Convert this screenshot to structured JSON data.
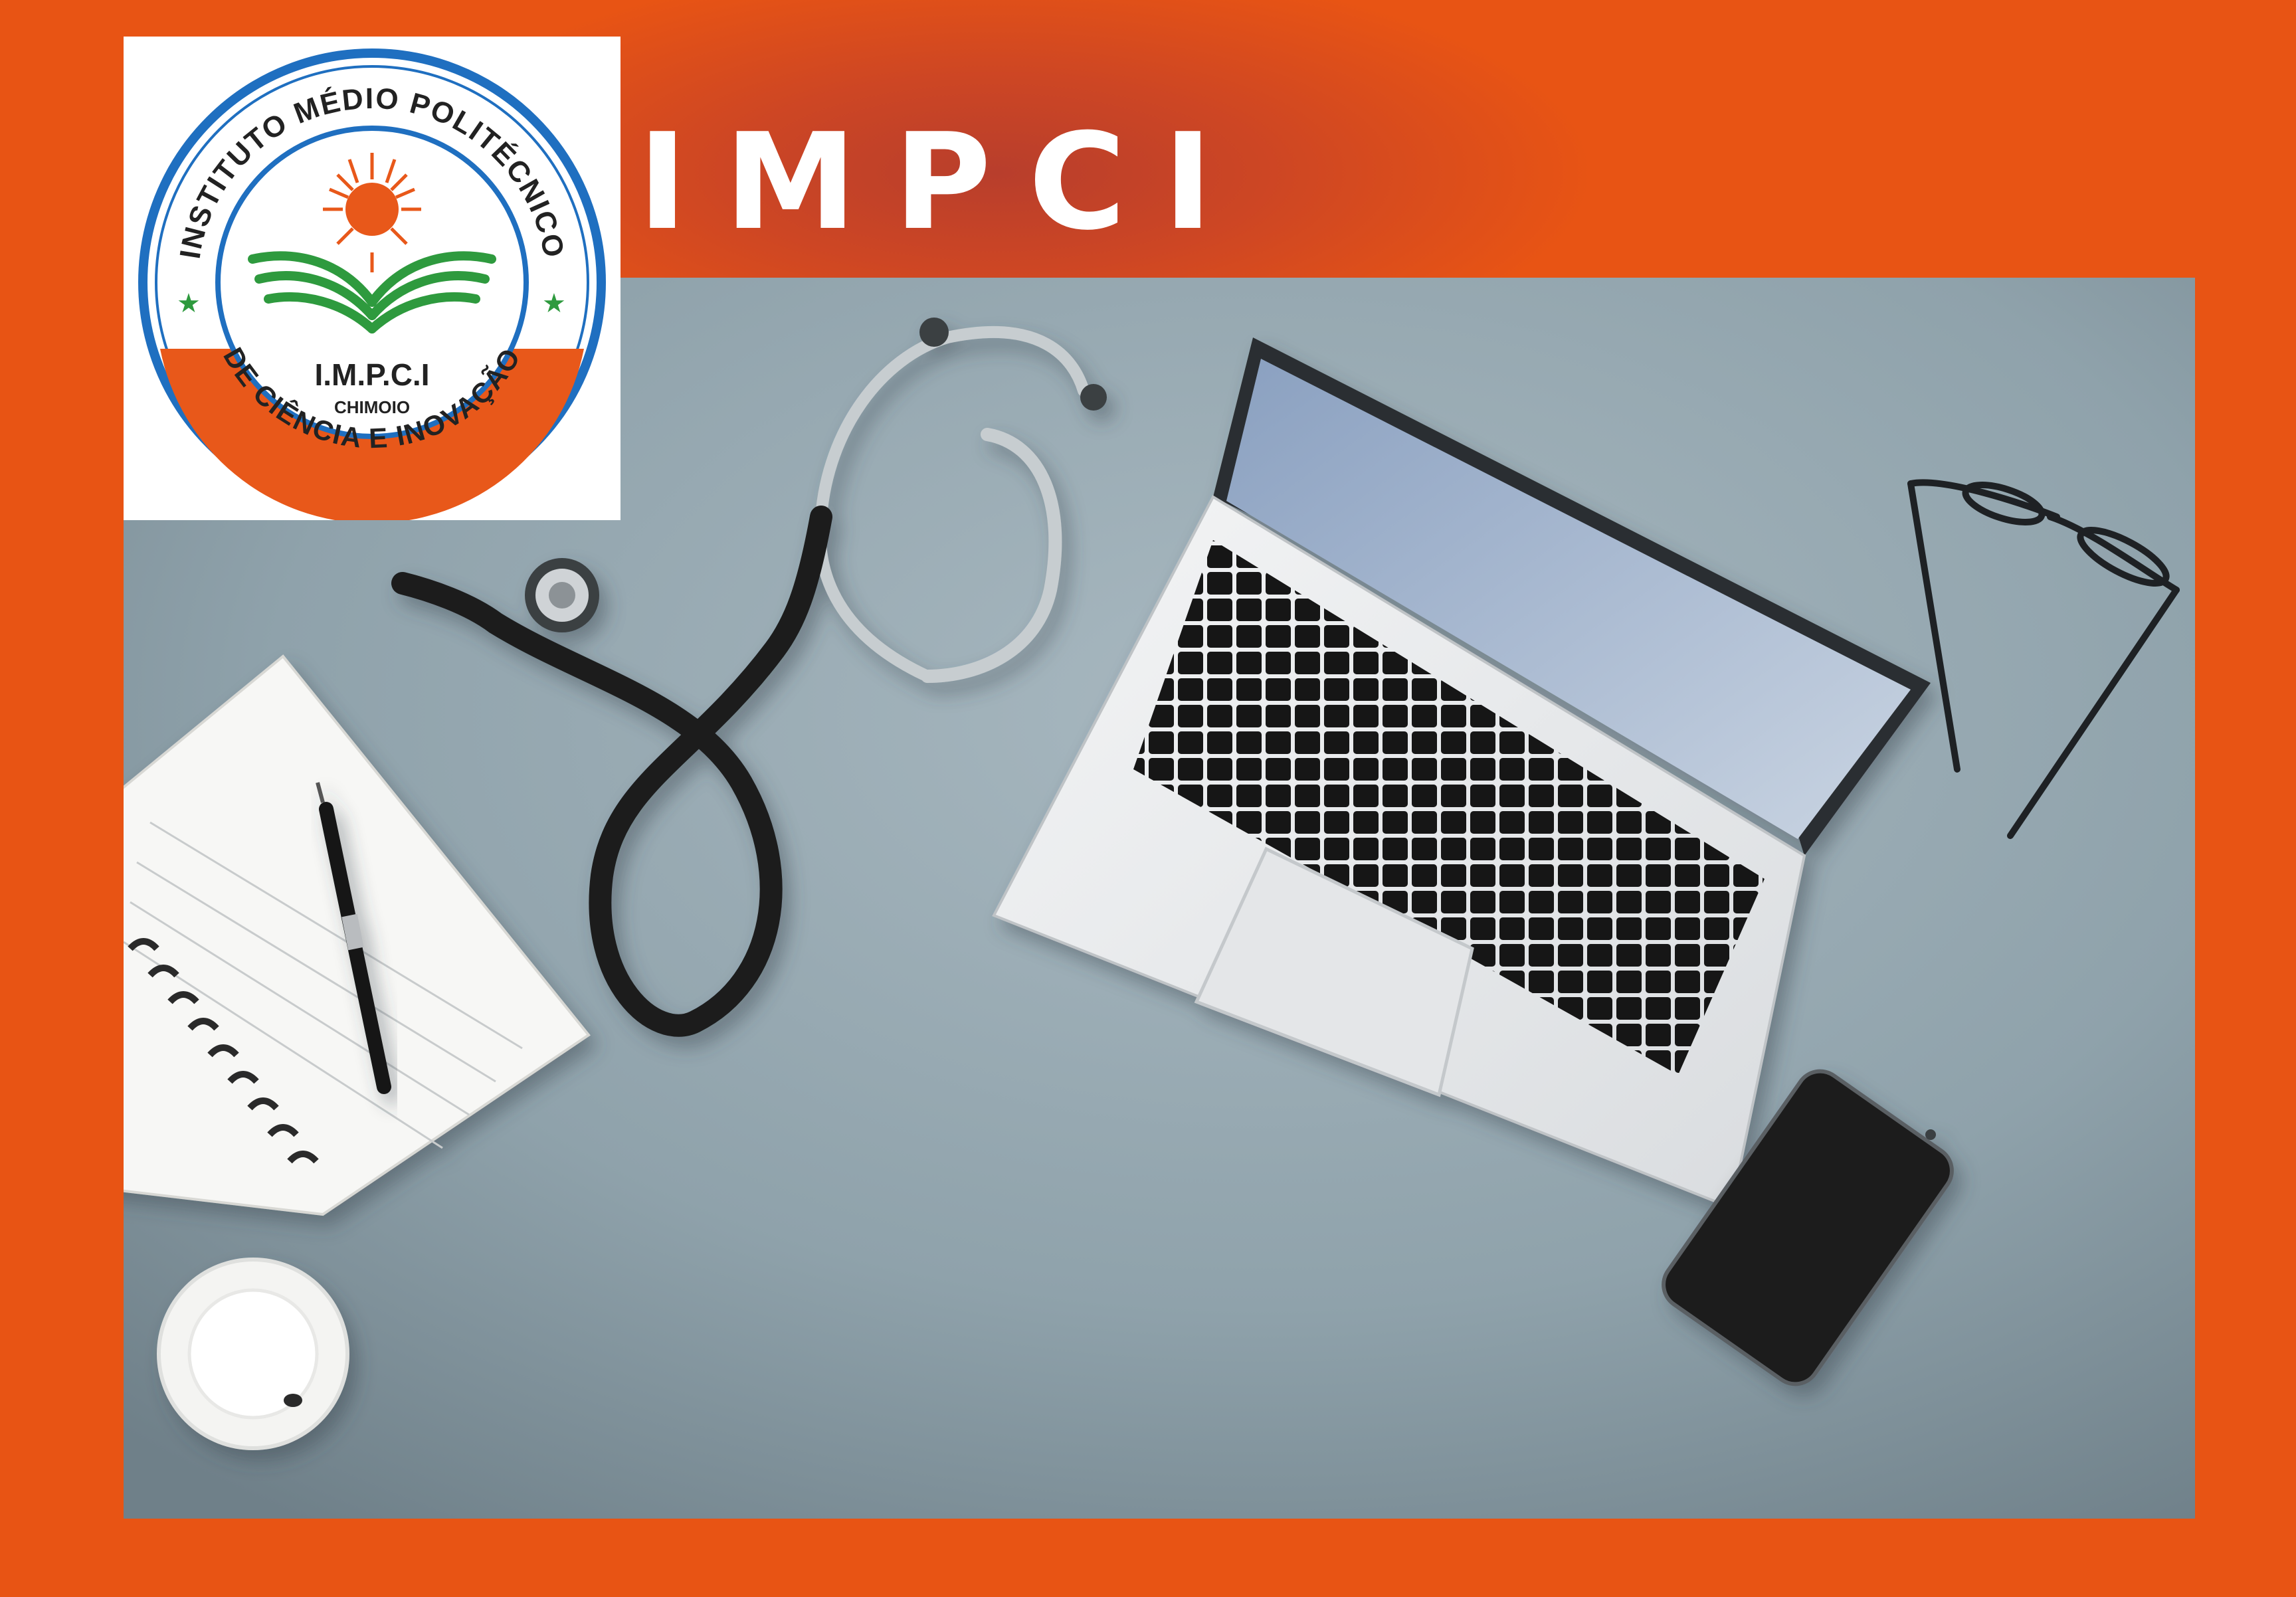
{
  "brand": {
    "title": "IMPCI",
    "colors": {
      "background": "#e85414",
      "title": "#ffffff",
      "photo_backdrop": "#8fa2ab"
    }
  },
  "logo": {
    "ring_top_text": "INSTITUTO MÉDIO POLITÉCNICO",
    "ring_bottom_text": "DE CIÊNCIA E INOVAÇÃO",
    "acronym": "I.M.P.C.I",
    "city": "CHIMOIO",
    "colors": {
      "ring": "#1f6fc0",
      "sun": "#e8581a",
      "book": "#2e9a3e",
      "text": "#222222"
    }
  },
  "photo": {
    "subject": "desk-flatlay",
    "objects": [
      "notebook-icon",
      "pen-icon",
      "stethoscope-icon",
      "laptop-icon",
      "glasses-icon",
      "smartphone-icon",
      "coffee-cup-icon"
    ]
  }
}
